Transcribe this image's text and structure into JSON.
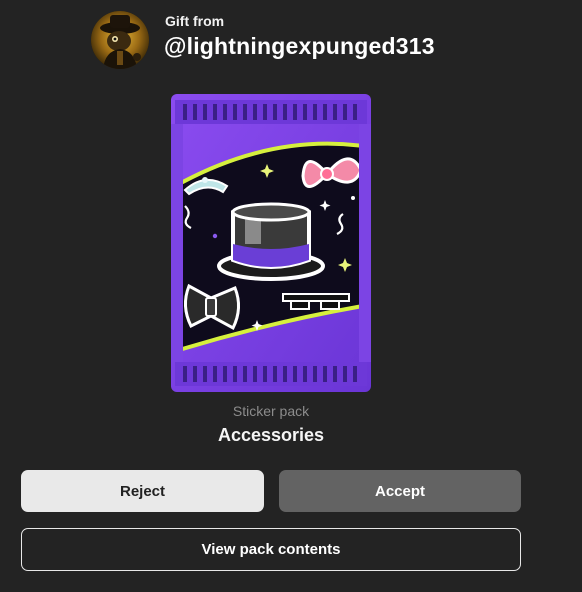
{
  "header": {
    "gift_from_label": "Gift from",
    "username": "@lightningexpunged313",
    "avatar_icon": "avatar-icon"
  },
  "pack": {
    "type_label": "Sticker pack",
    "name": "Accessories",
    "art_icons": [
      "top-hat-icon",
      "bow-icon",
      "bow-tie-icon",
      "tiara-icon",
      "pixel-sunglasses-icon"
    ],
    "colors": {
      "wrapper": "#7b3fe0",
      "band": "#2a1a55",
      "swoosh": "#d6f03d",
      "background": "#232323"
    }
  },
  "actions": {
    "reject_label": "Reject",
    "accept_label": "Accept",
    "view_contents_label": "View pack contents"
  }
}
